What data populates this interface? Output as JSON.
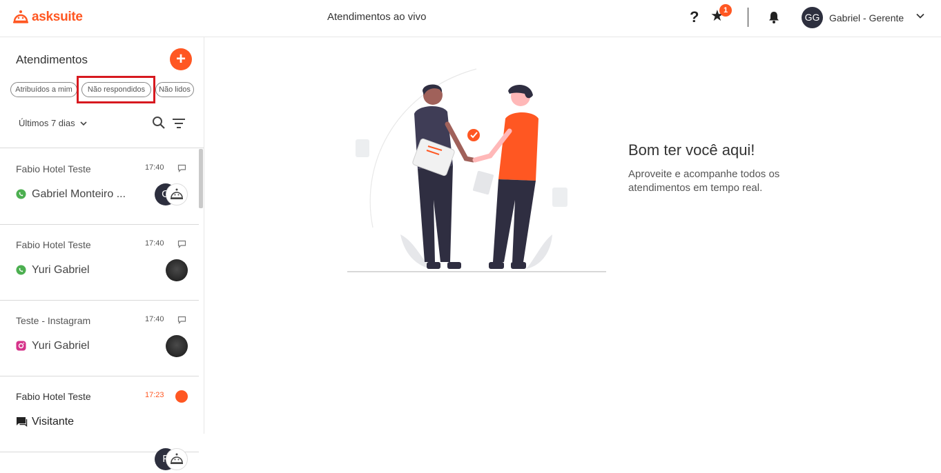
{
  "header": {
    "logo_text": "asksuite",
    "page_title": "Atendimentos ao vivo",
    "help_label": "?",
    "star_badge": "1",
    "user_initials": "GG",
    "user_name": "Gabriel - Gerente"
  },
  "sidebar": {
    "title": "Atendimentos",
    "add_label": "+",
    "filters": [
      "Atribuídos a mim",
      "Não respondidos",
      "Não lidos"
    ],
    "highlighted_filter": "Não respondidos",
    "period": "Últimos 7 dias"
  },
  "conversations": [
    {
      "hotel": "Fabio Hotel Teste",
      "time": "17:40",
      "channel": "whatsapp",
      "name": "Gabriel Monteiro ...",
      "avatar": "G",
      "bot": true,
      "unread": false
    },
    {
      "hotel": "Fabio Hotel Teste",
      "time": "17:40",
      "channel": "whatsapp",
      "name": "Yuri Gabriel",
      "avatar": "photo",
      "bot": false,
      "unread": false
    },
    {
      "hotel": "Teste - Instagram",
      "time": "17:40",
      "channel": "instagram",
      "name": "Yuri Gabriel",
      "avatar": "photo",
      "bot": false,
      "unread": false
    },
    {
      "hotel": "Fabio Hotel Teste",
      "time": "17:23",
      "channel": "chat",
      "name": "Visitante",
      "avatar": "F",
      "bot": true,
      "unread": true
    }
  ],
  "main": {
    "welcome_title": "Bom ter você aqui!",
    "welcome_text": "Aproveite e acompanhe todos os atendimentos em tempo real."
  },
  "colors": {
    "accent": "#ff5722",
    "highlight_box": "#d7191f",
    "dark": "#2d2f3e"
  }
}
